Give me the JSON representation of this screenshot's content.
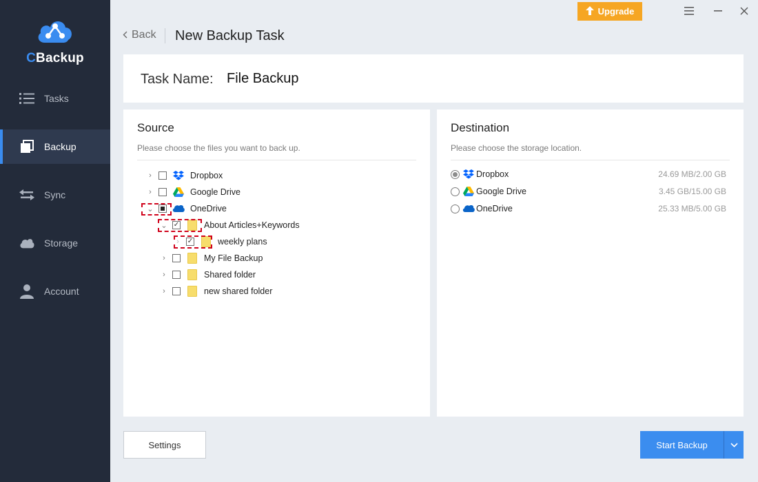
{
  "app": {
    "name_first_letter": "C",
    "name_rest": "Backup"
  },
  "sidebar": {
    "items": [
      {
        "label": "Tasks",
        "icon": "list-icon",
        "active": false
      },
      {
        "label": "Backup",
        "icon": "copy-icon",
        "active": true
      },
      {
        "label": "Sync",
        "icon": "sync-arrows-icon",
        "active": false
      },
      {
        "label": "Storage",
        "icon": "cloud-icon",
        "active": false
      },
      {
        "label": "Account",
        "icon": "user-icon",
        "active": false
      }
    ]
  },
  "titlebar": {
    "upgrade_label": "Upgrade"
  },
  "header": {
    "back_label": "Back",
    "title": "New Backup Task"
  },
  "task": {
    "label": "Task Name:",
    "value": "File Backup"
  },
  "source": {
    "title": "Source",
    "subtitle": "Please choose the files you want to back up.",
    "tree": [
      {
        "label": "Dropbox",
        "icon": "dropbox-icon",
        "expanded": false,
        "checked": "unchecked"
      },
      {
        "label": "Google Drive",
        "icon": "google-drive-icon",
        "expanded": false,
        "checked": "unchecked"
      },
      {
        "label": "OneDrive",
        "icon": "onedrive-icon",
        "expanded": true,
        "checked": "partial"
      },
      {
        "label": "About Articles+Keywords",
        "icon": "folder-icon",
        "expanded": true,
        "checked": "checked"
      },
      {
        "label": "weekly plans",
        "icon": "folder-icon",
        "expanded": false,
        "checked": "checked"
      },
      {
        "label": "My File Backup",
        "icon": "folder-icon",
        "expanded": false,
        "checked": "unchecked"
      },
      {
        "label": "Shared folder",
        "icon": "folder-icon",
        "expanded": false,
        "checked": "unchecked"
      },
      {
        "label": "new shared folder",
        "icon": "folder-icon",
        "expanded": false,
        "checked": "unchecked"
      }
    ]
  },
  "destination": {
    "title": "Destination",
    "subtitle": "Please choose the storage location.",
    "options": [
      {
        "label": "Dropbox",
        "icon": "dropbox-icon",
        "size": "24.69 MB/2.00 GB",
        "selected": true
      },
      {
        "label": "Google Drive",
        "icon": "google-drive-icon",
        "size": "3.45 GB/15.00 GB",
        "selected": false
      },
      {
        "label": "OneDrive",
        "icon": "onedrive-icon",
        "size": "25.33 MB/5.00 GB",
        "selected": false
      }
    ]
  },
  "footer": {
    "settings_label": "Settings",
    "start_label": "Start Backup"
  },
  "colors": {
    "sidebar_bg": "#232b3a",
    "accent": "#3b8def",
    "upgrade": "#f6a623",
    "highlight_dash": "#d0021b"
  }
}
